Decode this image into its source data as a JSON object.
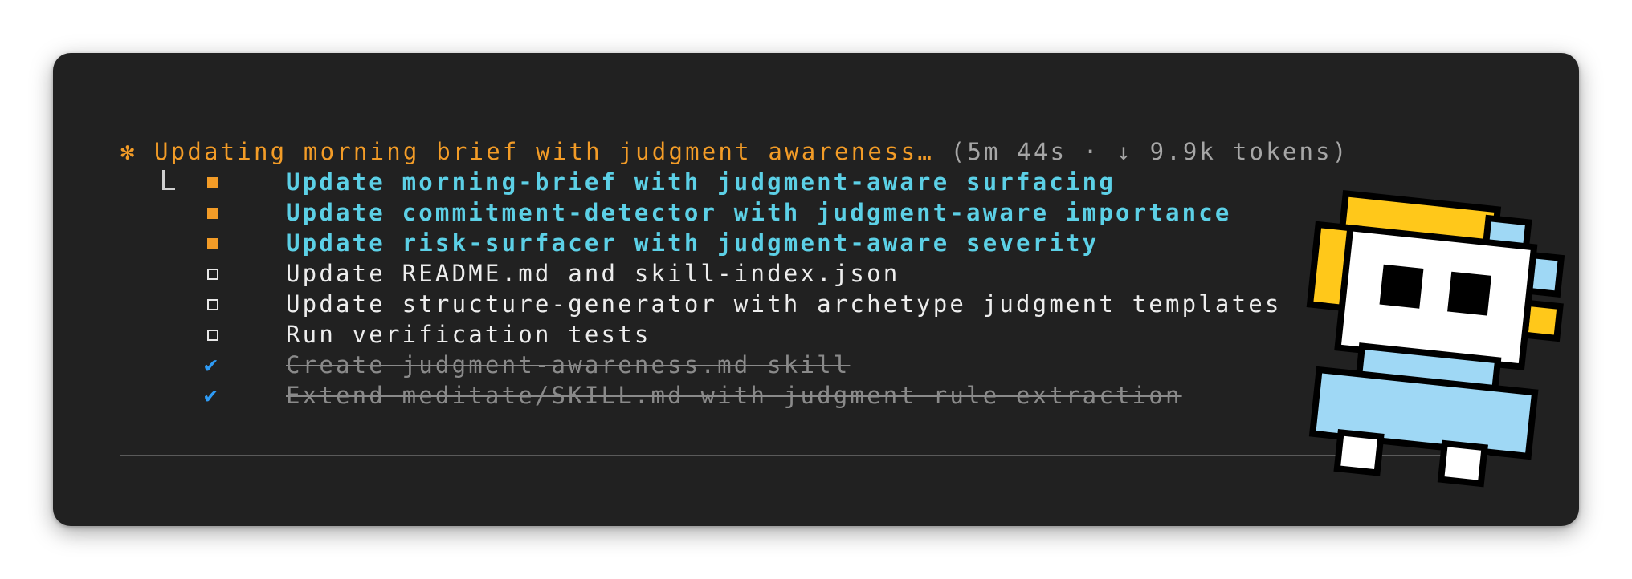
{
  "status": {
    "spinner_glyph": "✻",
    "text": "Updating morning brief with judgment awareness…",
    "meta": " (5m 44s · ↓ 9.9k tokens)"
  },
  "tasks": [
    {
      "state": "in_progress",
      "label": "Update morning-brief with judgment-aware surfacing"
    },
    {
      "state": "in_progress",
      "label": "Update commitment-detector with judgment-aware importance"
    },
    {
      "state": "in_progress",
      "label": "Update risk-surfacer with judgment-aware severity"
    },
    {
      "state": "pending",
      "label": "Update README.md and skill-index.json"
    },
    {
      "state": "pending",
      "label": "Update structure-generator with archetype judgment templates"
    },
    {
      "state": "pending",
      "label": "Run verification tests"
    },
    {
      "state": "completed",
      "label": "Create judgment-awareness.md skill"
    },
    {
      "state": "completed",
      "label": "Extend meditate/SKILL.md with judgment rule extraction"
    }
  ],
  "icons": {
    "check": "✔",
    "mascot": "pixel-robot-mascot-icon"
  },
  "colors": {
    "background": "#212121",
    "status": "#f39c27",
    "in_progress": "#5cd0e6",
    "pending": "#ededed",
    "completed": "#8a8a8a",
    "check": "#2e9bf5"
  }
}
